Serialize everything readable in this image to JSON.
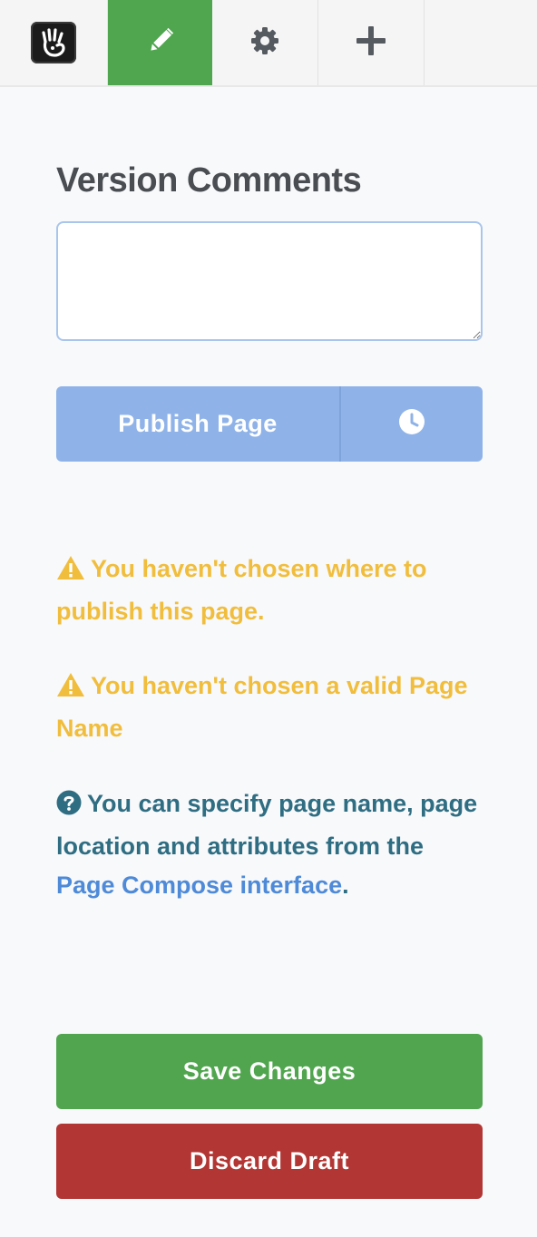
{
  "toolbar": {
    "logo_icon": "concrete-hand-logo-icon",
    "edit_icon": "pencil-icon",
    "settings_icon": "gear-icon",
    "add_icon": "plus-icon",
    "active_color": "#4fa64f"
  },
  "panel": {
    "heading": "Version Comments",
    "comment_value": "",
    "publish_label": "Publish Page",
    "schedule_icon": "clock-icon"
  },
  "messages": {
    "warning_1": "You haven't chosen where to publish this page.",
    "warning_2": "You haven't chosen a valid Page Name",
    "info_prefix": "You can specify page name, page location and attributes from the",
    "info_link": "Page Compose interface",
    "info_suffix": ".",
    "warning_color": "#f1bd3c",
    "info_color": "#2f6d82"
  },
  "actions": {
    "save_label": "Save Changes",
    "discard_label": "Discard Draft",
    "save_color": "#51a54f",
    "discard_color": "#b23633"
  }
}
